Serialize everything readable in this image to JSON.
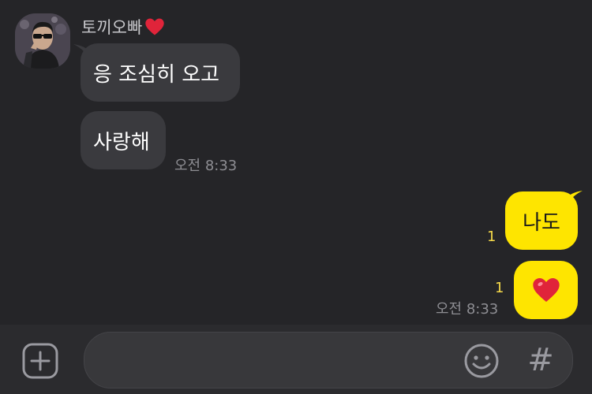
{
  "conversation": {
    "sender_name": "토끼오빠",
    "sender_badge_icon": "heart-icon",
    "incoming": [
      {
        "text": "응 조심히 오고"
      },
      {
        "text": "사랑해",
        "time": "오전 8:33"
      }
    ],
    "outgoing": [
      {
        "text": "나도",
        "unread": "1"
      },
      {
        "emoji": "heart-emoji",
        "unread": "1",
        "time": "오전 8:33"
      }
    ]
  },
  "input_bar": {
    "plus_icon": "plus-square-icon",
    "message_value": "",
    "emoji_icon": "smiley-icon",
    "hash_label": "#"
  },
  "colors": {
    "background": "#252528",
    "incoming_bubble": "#3a3a3e",
    "outgoing_bubble": "#fee500",
    "unread_count": "#f5d94a",
    "heart": "#e0243a"
  }
}
